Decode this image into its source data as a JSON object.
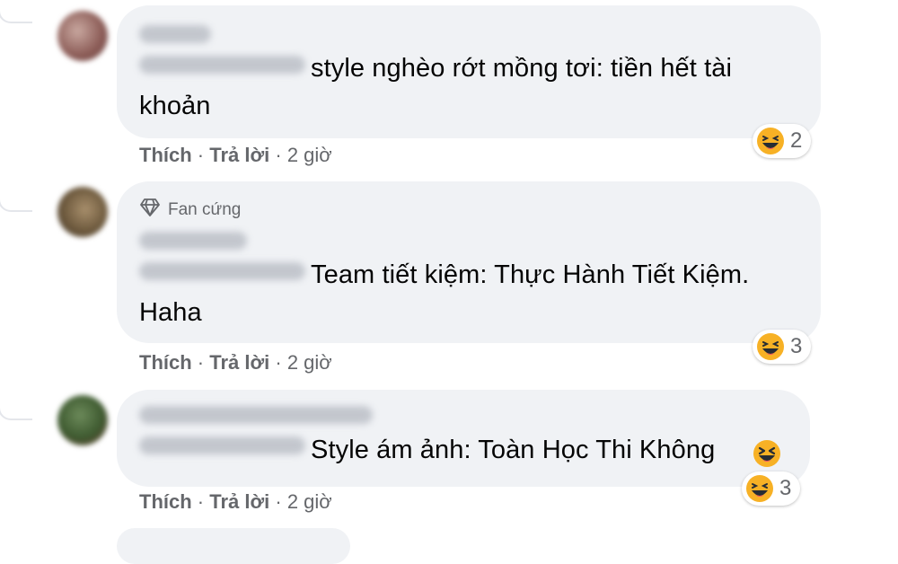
{
  "comments": [
    {
      "text_line1": "style nghèo rớt mồng tơi: tiền hết tài",
      "text_line2": "khoản",
      "actions": {
        "like": "Thích",
        "reply": "Trả lời",
        "time": "2 giờ"
      },
      "reaction": {
        "icon": "haha-icon",
        "count": "2"
      }
    },
    {
      "badge": {
        "icon": "diamond-icon",
        "label": "Fan cứng"
      },
      "text_line1": "Team tiết kiệm: Thực Hành Tiết Kiệm.",
      "text_line2": "Haha",
      "actions": {
        "like": "Thích",
        "reply": "Trả lời",
        "time": "2 giờ"
      },
      "reaction": {
        "icon": "haha-icon",
        "count": "3"
      }
    },
    {
      "text_line1": "Style ám ảnh: Toàn Học Thi Không",
      "inline_emoji": "laughing-squint-icon",
      "actions": {
        "like": "Thích",
        "reply": "Trả lời",
        "time": "2 giờ"
      },
      "reaction": {
        "icon": "haha-icon",
        "count": "3"
      }
    }
  ],
  "separator": "·",
  "colors": {
    "bubble": "#f0f2f5",
    "text": "#050505",
    "meta": "#65676b",
    "emoji": "#f7b125"
  }
}
